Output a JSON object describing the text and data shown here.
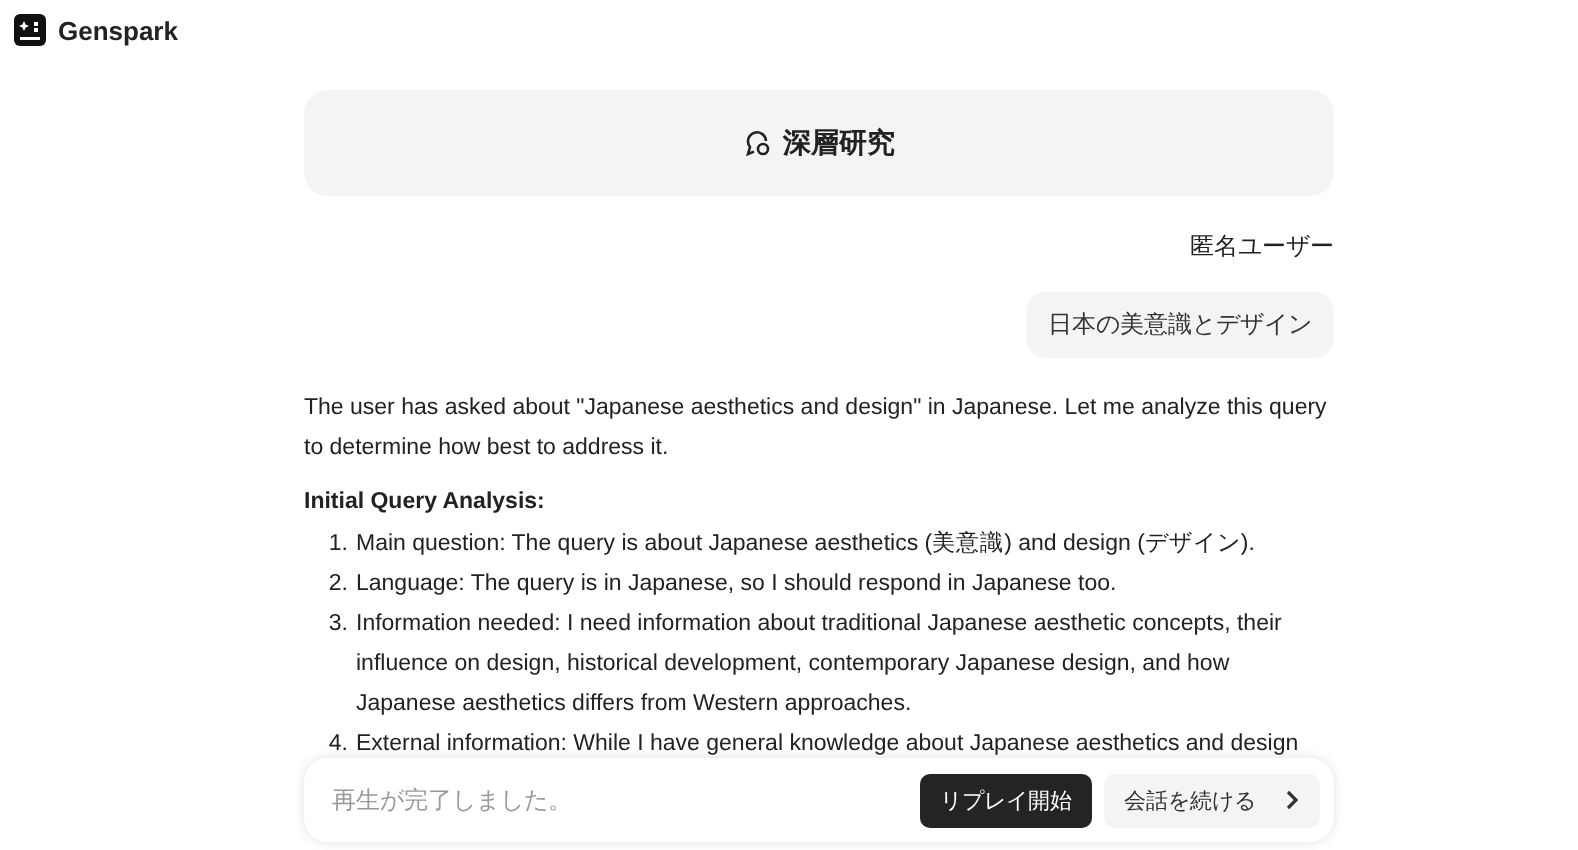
{
  "header": {
    "brand": "Genspark"
  },
  "mode_card": {
    "title": "深層研究"
  },
  "user": {
    "name": "匿名ユーザー",
    "message": "日本の美意識とデザイン"
  },
  "response": {
    "intro": "The user has asked about \"Japanese aesthetics and design\" in Japanese. Let me analyze this query to determine how best to address it.",
    "heading": "Initial Query Analysis:",
    "items": [
      {
        "number": "1.",
        "text": "Main question: The query is about Japanese aesthetics (美意識) and design (デザイン)."
      },
      {
        "number": "2.",
        "text": "Language: The query is in Japanese, so I should respond in Japanese too."
      },
      {
        "number": "3.",
        "text": "Information needed: I need information about traditional Japanese aesthetic concepts, their influence on design, historical development, contemporary Japanese design, and how Japanese aesthetics differs from Western approaches."
      },
      {
        "number": "4.",
        "text": "External information: While I have general knowledge about Japanese aesthetics and design"
      }
    ]
  },
  "bottom_bar": {
    "placeholder": "再生が完了しました。",
    "replay_button": "リプレイ開始",
    "continue_button": "会話を続ける"
  }
}
